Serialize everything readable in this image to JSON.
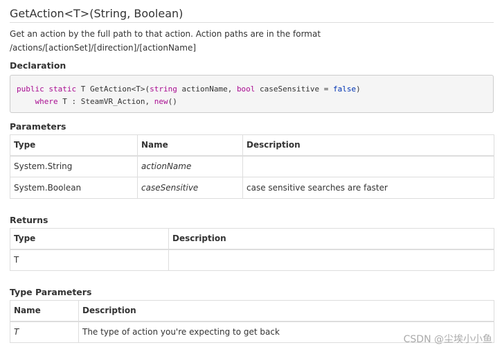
{
  "title": "GetAction<T>(String, Boolean)",
  "description": {
    "line1": "Get an action by the full path to that action. Action paths are in the format",
    "line2": "/actions/[actionSet]/[direction]/[actionName]"
  },
  "declaration": {
    "heading": "Declaration",
    "line1": {
      "kw_public": "public",
      "kw_static": "static",
      "sig_a": " T GetAction<T>(",
      "kw_string": "string",
      "sig_b": " actionName, ",
      "kw_bool": "bool",
      "sig_c": " caseSensitive = ",
      "kw_false": "false",
      "sig_d": ")"
    },
    "line2": {
      "kw_where": "where",
      "sig_a": " T : SteamVR_Action, ",
      "kw_new": "new",
      "sig_b": "()"
    }
  },
  "parameters": {
    "heading": "Parameters",
    "columns": [
      "Type",
      "Name",
      "Description"
    ],
    "rows": [
      {
        "type": "System.String",
        "name": "actionName",
        "description": ""
      },
      {
        "type": "System.Boolean",
        "name": "caseSensitive",
        "description": "case sensitive searches are faster"
      }
    ]
  },
  "returns": {
    "heading": "Returns",
    "columns": [
      "Type",
      "Description"
    ],
    "rows": [
      {
        "type": "T",
        "description": ""
      }
    ]
  },
  "type_parameters": {
    "heading": "Type Parameters",
    "columns": [
      "Name",
      "Description"
    ],
    "rows": [
      {
        "name": "T",
        "description": "The type of action you're expecting to get back"
      }
    ]
  },
  "watermark": "CSDN @尘埃小小鱼"
}
